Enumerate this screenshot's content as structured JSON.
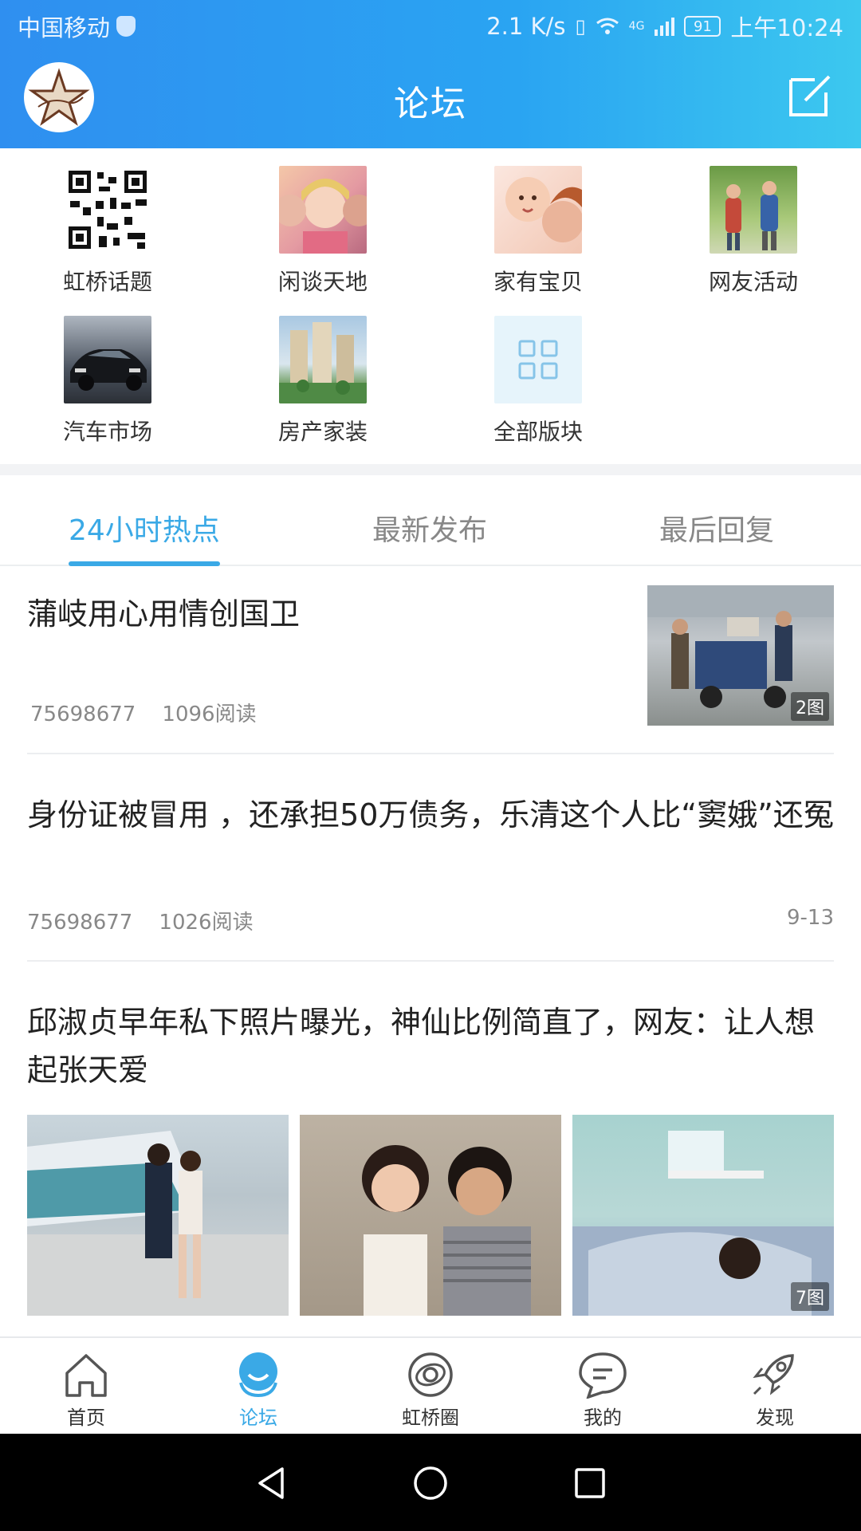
{
  "status_bar": {
    "carrier": "中国移动",
    "speed": "2.1 K/s",
    "network": "4G",
    "battery": "91",
    "time": "上午10:24"
  },
  "header": {
    "title": "论坛"
  },
  "categories": [
    {
      "label": "虹桥话题",
      "icon": "qr-code-icon"
    },
    {
      "label": "闲谈天地",
      "icon": "girls-photo"
    },
    {
      "label": "家有宝贝",
      "icon": "baby-photo"
    },
    {
      "label": "网友活动",
      "icon": "hikers-photo"
    },
    {
      "label": "汽车市场",
      "icon": "car-photo"
    },
    {
      "label": "房产家装",
      "icon": "buildings-photo"
    },
    {
      "label": "全部版块",
      "icon": "grid-icon"
    }
  ],
  "tabs": [
    {
      "label": "24小时热点",
      "active": true
    },
    {
      "label": "最新发布",
      "active": false
    },
    {
      "label": "最后回复",
      "active": false
    }
  ],
  "posts": [
    {
      "title": "蒲岐用心用情创国卫",
      "user": "75698677",
      "reads": "1096阅读",
      "image_badge": "2图"
    },
    {
      "title": "身份证被冒用 ，还承担50万债务，乐清这个人比“窦娥”还冤",
      "user": "75698677",
      "reads": "1026阅读",
      "date": "9-13"
    },
    {
      "title": "邱淑贞早年私下照片曝光，神仙比例简直了，网友：让人想起张天爱",
      "image_badge": "7图"
    }
  ],
  "bottom_nav": [
    {
      "label": "首页",
      "icon": "home-icon",
      "active": false
    },
    {
      "label": "论坛",
      "icon": "forum-icon",
      "active": true
    },
    {
      "label": "虹桥圈",
      "icon": "planet-icon",
      "active": false
    },
    {
      "label": "我的",
      "icon": "chat-bubble-icon",
      "active": false
    },
    {
      "label": "发现",
      "icon": "rocket-icon",
      "active": false
    }
  ],
  "colors": {
    "accent": "#3aa9e6",
    "header_gradient_start": "#2f8ff0",
    "header_gradient_end": "#3cc8ef"
  }
}
